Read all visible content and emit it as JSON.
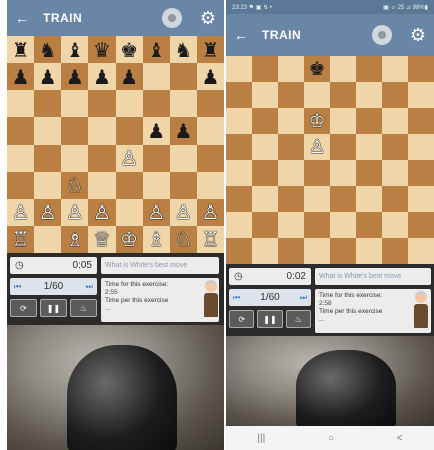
{
  "left": {
    "appbar": {
      "title": "TRAIN",
      "back_glyph": "←",
      "settings_glyph": "⚙"
    },
    "board": [
      [
        "♜",
        "♞",
        "♝",
        "♛",
        "♚",
        "♝",
        "♞",
        "♜"
      ],
      [
        "♟",
        "♟",
        "♟",
        "♟",
        "♟",
        "",
        "",
        "♟"
      ],
      [
        "",
        "",
        "",
        "",
        "",
        "",
        "",
        ""
      ],
      [
        "",
        "",
        "",
        "",
        "",
        "♟",
        "♟",
        ""
      ],
      [
        "",
        "",
        "",
        "",
        "♙",
        "",
        "",
        ""
      ],
      [
        "",
        "",
        "♘",
        "",
        "",
        "",
        "",
        ""
      ],
      [
        "♙",
        "♙",
        "♙",
        "♙",
        "",
        "♙",
        "♙",
        "♙"
      ],
      [
        "♖",
        "",
        "♗",
        "♕",
        "♔",
        "♗",
        "♘",
        "♖"
      ]
    ],
    "timer": "0:05",
    "page": "1/60",
    "question": "What is White's best move",
    "info_line1": "Time for this exercise:",
    "info_val1": "2:55",
    "info_line2": "Time per this exercise",
    "info_val2": "..."
  },
  "right": {
    "status": {
      "time": "23:23 ⚑ ▣ ↯ •",
      "right": "▣ ☼ 25 ⊿ 98%▮"
    },
    "appbar": {
      "title": "TRAIN",
      "back_glyph": "←",
      "settings_glyph": "⚙"
    },
    "board": [
      [
        "",
        "",
        "",
        "♚",
        "",
        "",
        "",
        ""
      ],
      [
        "",
        "",
        "",
        "",
        "",
        "",
        "",
        ""
      ],
      [
        "",
        "",
        "",
        "♔",
        "",
        "",
        "",
        ""
      ],
      [
        "",
        "",
        "",
        "♙",
        "",
        "",
        "",
        ""
      ],
      [
        "",
        "",
        "",
        "",
        "",
        "",
        "",
        ""
      ],
      [
        "",
        "",
        "",
        "",
        "",
        "",
        "",
        ""
      ],
      [
        "",
        "",
        "",
        "",
        "",
        "",
        "",
        ""
      ],
      [
        "",
        "",
        "",
        "",
        "",
        "",
        "",
        ""
      ]
    ],
    "timer": "0:02",
    "page": "1/60",
    "question": "What is White's best move",
    "info_line1": "Time for this exercise:",
    "info_val1": "2:58",
    "info_line2": "Time per this exercise",
    "info_val2": "...",
    "navbar": [
      "|||",
      "○",
      "<"
    ]
  },
  "controls": {
    "restart": "⟳",
    "pause": "❚❚",
    "hint": "💡"
  },
  "icons": {
    "clock": "clock-icon",
    "first": "skip-first-icon",
    "last": "skip-last-icon"
  }
}
